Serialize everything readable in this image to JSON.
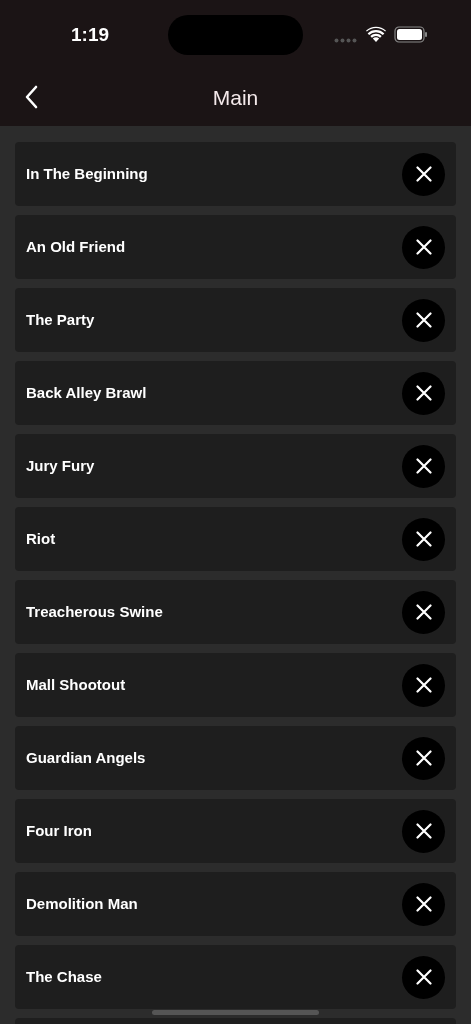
{
  "status_bar": {
    "time": "1:19"
  },
  "nav_bar": {
    "title": "Main"
  },
  "items": [
    {
      "title": "In The Beginning"
    },
    {
      "title": "An Old Friend"
    },
    {
      "title": "The Party"
    },
    {
      "title": "Back Alley Brawl"
    },
    {
      "title": "Jury Fury"
    },
    {
      "title": "Riot"
    },
    {
      "title": "Treacherous Swine"
    },
    {
      "title": "Mall Shootout"
    },
    {
      "title": "Guardian Angels"
    },
    {
      "title": "Four Iron"
    },
    {
      "title": "Demolition Man"
    },
    {
      "title": "The Chase"
    }
  ]
}
